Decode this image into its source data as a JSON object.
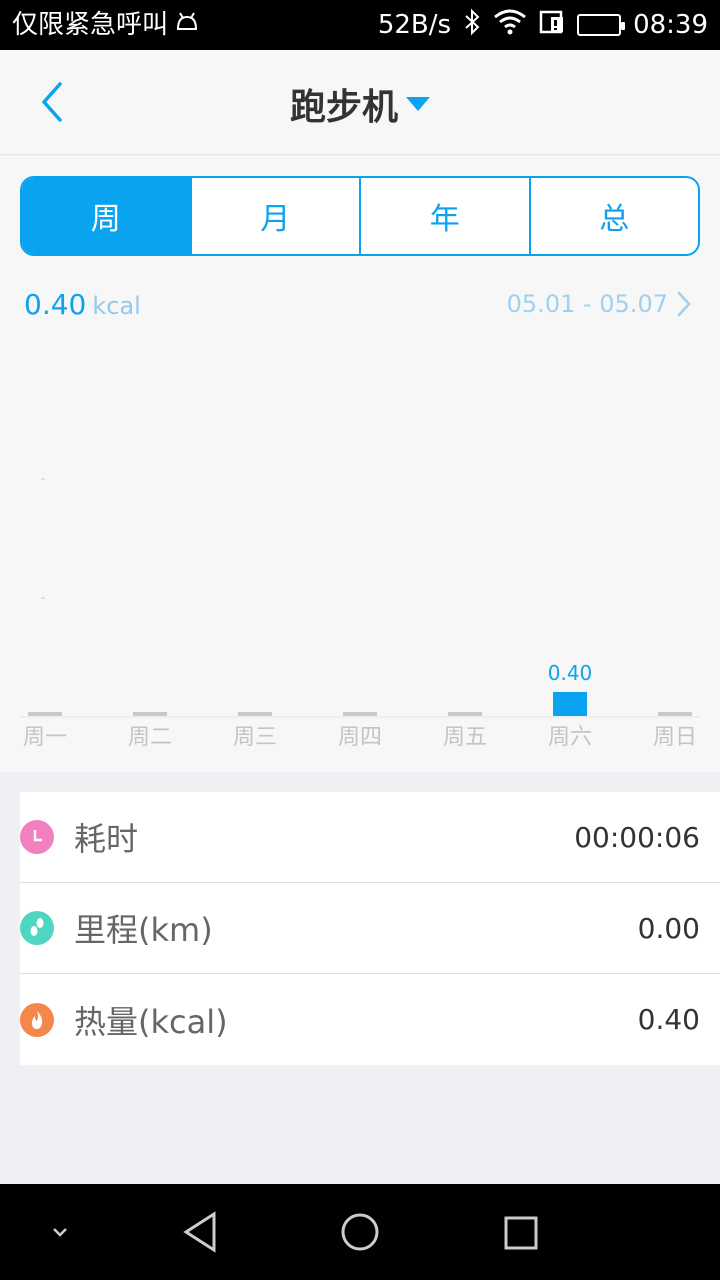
{
  "status_bar": {
    "carrier_text": "仅限紧急呼叫",
    "network_speed": "52B/s",
    "time": "08:39",
    "icons": [
      "android-icon",
      "bluetooth-icon",
      "wifi-icon",
      "sim-icon",
      "battery-icon"
    ]
  },
  "header": {
    "title": "跑步机"
  },
  "tabs": [
    {
      "label": "周",
      "active": true
    },
    {
      "label": "月",
      "active": false
    },
    {
      "label": "年",
      "active": false
    },
    {
      "label": "总",
      "active": false
    }
  ],
  "summary": {
    "value": "0.40",
    "unit": "kcal",
    "date_range": "05.01 - 05.07"
  },
  "chart_data": {
    "type": "bar",
    "categories": [
      "周一",
      "周二",
      "周三",
      "周四",
      "周五",
      "周六",
      "周日"
    ],
    "values": [
      0,
      0,
      0,
      0,
      0,
      0.4,
      0
    ],
    "data_labels": [
      "",
      "",
      "",
      "",
      "",
      "0.40",
      ""
    ],
    "title": "",
    "xlabel": "",
    "ylabel": "",
    "ylim": [
      0,
      1.4
    ],
    "grid": false,
    "bar_color": "#0aa3ef",
    "zero_bar_color": "#c8c8c8"
  },
  "stats": [
    {
      "label": "耗时",
      "value": "00:00:06",
      "icon": "clock-icon",
      "color": "#f27fbf"
    },
    {
      "label": "里程(km)",
      "value": "0.00",
      "icon": "footprint-icon",
      "color": "#4fd6c1"
    },
    {
      "label": "热量(kcal)",
      "value": "0.40",
      "icon": "flame-icon",
      "color": "#f4884a"
    }
  ],
  "colors": {
    "accent": "#0aa3ef",
    "title_text": "#333333"
  }
}
